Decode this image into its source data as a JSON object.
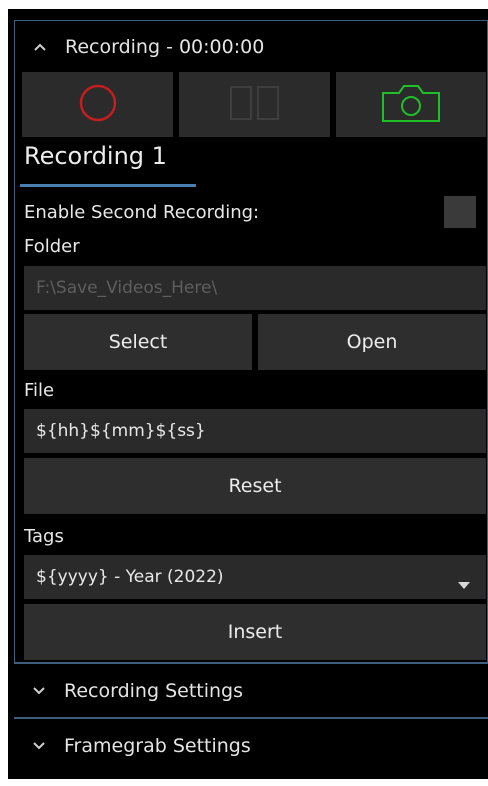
{
  "recording_section": {
    "title": "Recording - 00:00:00"
  },
  "toolbar": {
    "record_icon": "record-circle-icon",
    "pause_icon": "pause-icon",
    "snapshot_icon": "camera-icon",
    "colors": {
      "record": "#c41e1e",
      "pause": "#3a3a3a",
      "snapshot": "#1fbf2a"
    }
  },
  "tab": {
    "label": "Recording 1"
  },
  "second_recording": {
    "label": "Enable Second Recording:",
    "checked": false
  },
  "folder": {
    "label": "Folder",
    "path_placeholder": "F:\\Save_Videos_Here\\",
    "select_label": "Select",
    "open_label": "Open"
  },
  "file": {
    "label": "File",
    "value": "${hh}${mm}${ss}",
    "reset_label": "Reset"
  },
  "tags": {
    "label": "Tags",
    "selected": "${yyyy} - Year (2022)",
    "insert_label": "Insert"
  },
  "sections": {
    "recording_settings": "Recording Settings",
    "framegrab_settings": "Framegrab Settings"
  }
}
